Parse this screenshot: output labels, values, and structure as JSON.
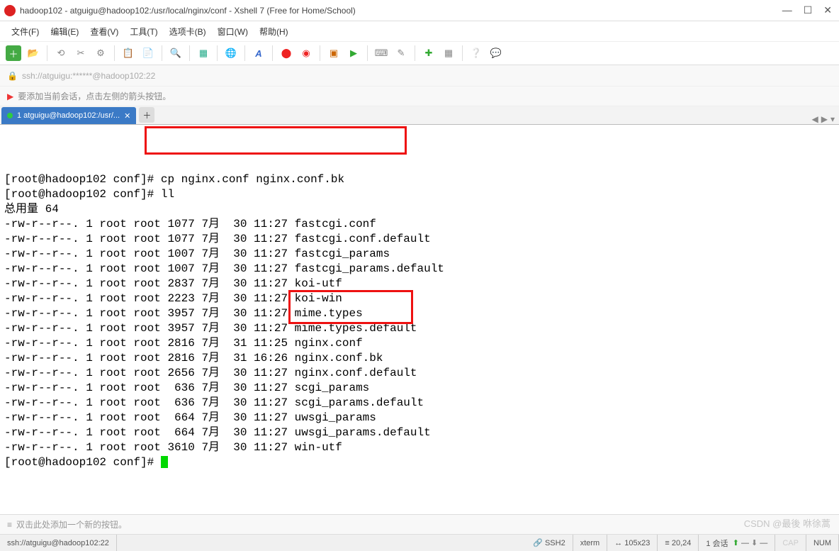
{
  "window": {
    "title": "hadoop102 - atguigu@hadoop102:/usr/local/nginx/conf - Xshell 7 (Free for Home/School)"
  },
  "menu": {
    "file": "文件(F)",
    "edit": "编辑(E)",
    "view": "查看(V)",
    "tools": "工具(T)",
    "tab": "选项卡(B)",
    "window": "窗口(W)",
    "help": "帮助(H)"
  },
  "address": "ssh://atguigu:******@hadoop102:22",
  "session_hint": "要添加当前会话，点击左侧的箭头按钮。",
  "tab_label": "1 atguigu@hadoop102:/usr/...",
  "terminal": {
    "prompt1": "[root@hadoop102 conf]# ",
    "cmd1": "cp nginx.conf nginx.conf.bk",
    "prompt2": "[root@hadoop102 conf]# ll",
    "total": "总用量 64",
    "rows": [
      "-rw-r--r--. 1 root root 1077 7月  30 11:27 fastcgi.conf",
      "-rw-r--r--. 1 root root 1077 7月  30 11:27 fastcgi.conf.default",
      "-rw-r--r--. 1 root root 1007 7月  30 11:27 fastcgi_params",
      "-rw-r--r--. 1 root root 1007 7月  30 11:27 fastcgi_params.default",
      "-rw-r--r--. 1 root root 2837 7月  30 11:27 koi-utf",
      "-rw-r--r--. 1 root root 2223 7月  30 11:27 koi-win",
      "-rw-r--r--. 1 root root 3957 7月  30 11:27 mime.types",
      "-rw-r--r--. 1 root root 3957 7月  30 11:27 mime.types.default",
      "-rw-r--r--. 1 root root 2816 7月  31 11:25 nginx.conf",
      "-rw-r--r--. 1 root root 2816 7月  31 16:26 nginx.conf.bk",
      "-rw-r--r--. 1 root root 2656 7月  30 11:27 nginx.conf.default",
      "-rw-r--r--. 1 root root  636 7月  30 11:27 scgi_params",
      "-rw-r--r--. 1 root root  636 7月  30 11:27 scgi_params.default",
      "-rw-r--r--. 1 root root  664 7月  30 11:27 uwsgi_params",
      "-rw-r--r--. 1 root root  664 7月  30 11:27 uwsgi_params.default",
      "-rw-r--r--. 1 root root 3610 7月  30 11:27 win-utf"
    ],
    "prompt3": "[root@hadoop102 conf]# "
  },
  "bottom_hint": "双击此处添加一个新的按钮。",
  "status": {
    "path": "ssh://atguigu@hadoop102:22",
    "ssh": "SSH2",
    "term": "xterm",
    "size": "105x23",
    "cursor": "20,24",
    "sessions": "1 会话",
    "cap": "CAP",
    "num": "NUM"
  },
  "watermark": "CSDN @最後 咻徐蒿"
}
